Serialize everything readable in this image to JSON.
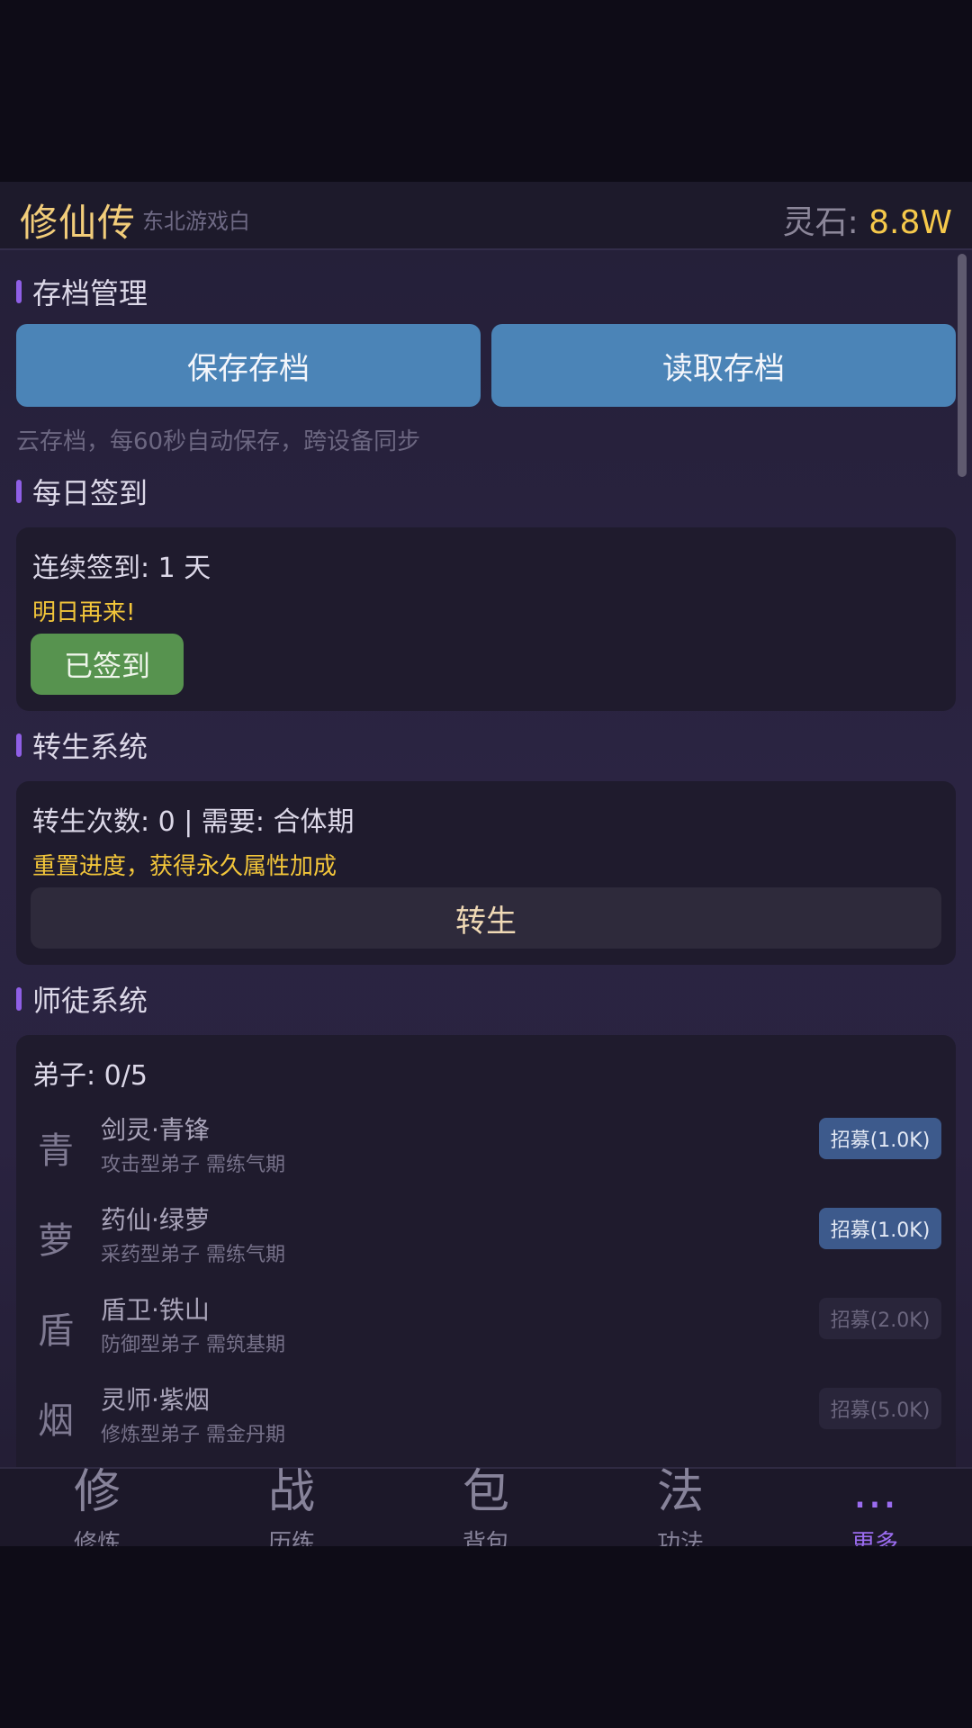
{
  "header": {
    "title": "修仙传",
    "subtitle": "东北游戏白",
    "currency_label": "灵石: ",
    "currency_value": "8.8W"
  },
  "save": {
    "heading": "存档管理",
    "save_label": "保存存档",
    "load_label": "读取存档",
    "hint": "云存档，每60秒自动保存，跨设备同步"
  },
  "checkin": {
    "heading": "每日签到",
    "streak": "连续签到: 1 天",
    "message": "明日再来!",
    "button": "已签到"
  },
  "rebirth": {
    "heading": "转生系统",
    "info": "转生次数: 0 | 需要: 合体期",
    "desc": "重置进度，获得永久属性加成",
    "button": "转生"
  },
  "mentor": {
    "heading": "师徒系统",
    "count": "弟子: 0/5",
    "disciples": [
      {
        "glyph": "青",
        "name": "剑灵·青锋",
        "desc": "攻击型弟子 需练气期",
        "recruit": "招募(1.0K)",
        "enabled": true
      },
      {
        "glyph": "萝",
        "name": "药仙·绿萝",
        "desc": "采药型弟子 需练气期",
        "recruit": "招募(1.0K)",
        "enabled": true
      },
      {
        "glyph": "盾",
        "name": "盾卫·铁山",
        "desc": "防御型弟子 需筑基期",
        "recruit": "招募(2.0K)",
        "enabled": false
      },
      {
        "glyph": "烟",
        "name": "灵师·紫烟",
        "desc": "修炼型弟子 需金丹期",
        "recruit": "招募(5.0K)",
        "enabled": false
      }
    ]
  },
  "nav": [
    {
      "icon": "修",
      "label": "修炼",
      "active": false
    },
    {
      "icon": "战",
      "label": "历练",
      "active": false
    },
    {
      "icon": "包",
      "label": "背包",
      "active": false
    },
    {
      "icon": "法",
      "label": "功法",
      "active": false
    },
    {
      "icon": "...",
      "label": "更多",
      "active": true
    }
  ]
}
